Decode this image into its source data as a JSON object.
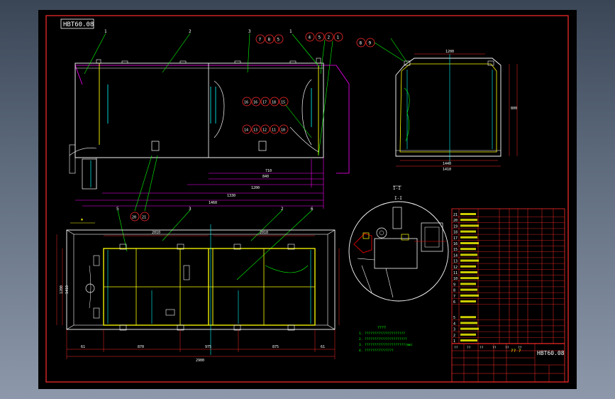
{
  "drawing": {
    "title_tag": "HBT60.08",
    "title_block_code": "HBT60.08",
    "title_block_small": "?? ?",
    "notes_title": "????",
    "notes": [
      "1. ?????????????????????",
      "2. ??????????????????????",
      "3. ?????????????????????(mm)",
      "4. ???????????????"
    ]
  },
  "balloons": {
    "front": [
      "7",
      "8",
      "5",
      "4",
      "5",
      "2",
      "1"
    ],
    "side": [
      "8",
      "9"
    ],
    "mid_row_a": [
      "16",
      "16",
      "17",
      "18",
      "15"
    ],
    "mid_row_b": [
      "14",
      "13",
      "12",
      "11",
      "10"
    ],
    "bottom": [
      "20",
      "21"
    ]
  },
  "leaders": {
    "l1": "1",
    "l2": "2",
    "l3": "3",
    "p4": "4",
    "p3": "3",
    "p2": "2",
    "p5": "5",
    "p6": "6",
    "p1": "1"
  },
  "dimensions": {
    "front": [
      "710",
      "840",
      "1200",
      "1330",
      "1460"
    ],
    "side": [
      "1200",
      "1440",
      "800",
      "1410"
    ],
    "plan_top": [
      "2010",
      "2010"
    ],
    "plan_bottom": [
      "61",
      "870",
      "975",
      "875",
      "61",
      "2900"
    ],
    "plan_left": [
      "1410",
      "1200"
    ]
  },
  "section_label": "I-I",
  "parts_upper": [
    "21",
    "20",
    "19",
    "18",
    "17",
    "16",
    "15",
    "14",
    "13",
    "12",
    "11",
    "10",
    "9",
    "8",
    "7",
    "6"
  ],
  "parts_lower": [
    "5",
    "4",
    "3",
    "2",
    "1"
  ],
  "parts_header": [
    "??",
    "??",
    "??",
    "??",
    "??",
    "??"
  ],
  "colors": {
    "bg": "#000000",
    "frame": "#ff2b2b",
    "outline": "#ffffff",
    "yellow": "#ffff00",
    "green": "#00ff00",
    "cyan": "#00ffff",
    "magenta": "#ff00ff",
    "red": "#ff0000"
  }
}
